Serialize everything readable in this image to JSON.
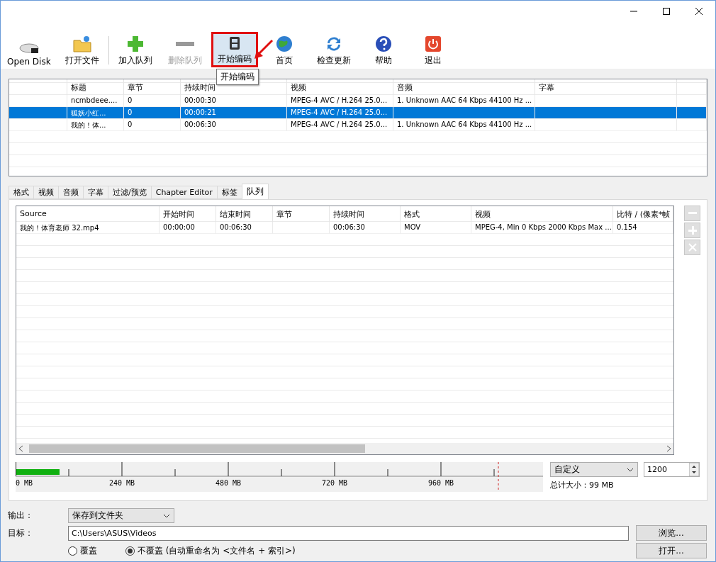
{
  "toolbar": [
    {
      "label": "Open Disk",
      "disabled": false,
      "highlighted": false
    },
    {
      "label": "打开文件",
      "disabled": false,
      "highlighted": false
    },
    {
      "label": "加入队列",
      "disabled": false,
      "highlighted": false
    },
    {
      "label": "删除队列",
      "disabled": true,
      "highlighted": false
    },
    {
      "label": "开始编码",
      "disabled": false,
      "highlighted": true
    },
    {
      "label": "首页",
      "disabled": false,
      "highlighted": false
    },
    {
      "label": "检查更新",
      "disabled": false,
      "highlighted": false
    },
    {
      "label": "帮助",
      "disabled": false,
      "highlighted": false
    },
    {
      "label": "退出",
      "disabled": false,
      "highlighted": false
    }
  ],
  "tooltip": "开始编码",
  "titles_table": {
    "columns": [
      "标题",
      "章节",
      "持续时间",
      "视频",
      "音频",
      "字幕"
    ],
    "rows": [
      {
        "selected": false,
        "cells": [
          "ncmbdeee....",
          "0",
          "00:00:30",
          "MPEG-4 AVC / H.264 25.0...",
          "1. Unknown AAC  64 Kbps 44100 Hz ...",
          ""
        ]
      },
      {
        "selected": true,
        "cells": [
          "狐妖小红...",
          "0",
          "00:00:21",
          "MPEG-4 AVC / H.264 25.0...",
          "",
          ""
        ]
      },
      {
        "selected": false,
        "cells": [
          "我的！体...",
          "0",
          "00:06:30",
          "MPEG-4 AVC / H.264 25.0...",
          "1. Unknown AAC  64 Kbps 44100 Hz ...",
          ""
        ]
      }
    ]
  },
  "tabs": [
    {
      "label": "格式",
      "selected": false
    },
    {
      "label": "视频",
      "selected": false
    },
    {
      "label": "音频",
      "selected": false
    },
    {
      "label": "字幕",
      "selected": false
    },
    {
      "label": "过滤/预览",
      "selected": false
    },
    {
      "label": "Chapter Editor",
      "selected": false
    },
    {
      "label": "标签",
      "selected": false
    },
    {
      "label": "队列",
      "selected": true
    }
  ],
  "queue_table": {
    "columns": [
      "Source",
      "开始时间",
      "结束时间",
      "章节",
      "持续时间",
      "格式",
      "视频",
      "比特 / (像素*帧"
    ],
    "rows": [
      {
        "cells": [
          "我的！体育老师 32.mp4",
          "00:00:00",
          "00:06:30",
          "",
          "00:06:30",
          "MOV",
          "MPEG-4, Min 0 Kbps 2000 Kbps Max ...",
          "0.154"
        ]
      }
    ]
  },
  "size_bar": {
    "level": 0.083,
    "ticks": [
      "0 MB",
      "240 MB",
      "480 MB",
      "720 MB",
      "960 MB"
    ]
  },
  "size_preset": "自定义",
  "size_value": "1200",
  "total_size": "总计大小：99 MB",
  "output": {
    "label": "输出：",
    "value": "保存到文件夹"
  },
  "target": {
    "label": "目标：",
    "value": "C:\\Users\\ASUS\\Videos"
  },
  "buttons": [
    "浏览...",
    "打开..."
  ],
  "overwrite": [
    {
      "label": "覆盖",
      "selected": false
    },
    {
      "label": "不覆盖 (自动重命名为 <文件名 + 索引>)",
      "selected": true
    }
  ]
}
